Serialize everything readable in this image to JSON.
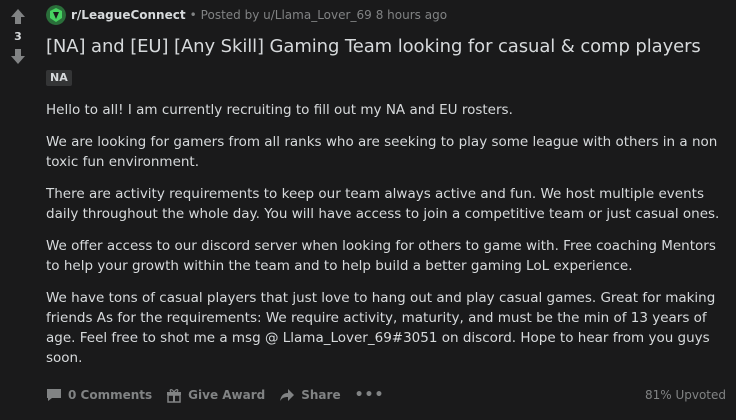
{
  "vote": {
    "count": "3"
  },
  "meta": {
    "subreddit": "r/LeagueConnect",
    "separator": "•",
    "posted_by": "Posted by",
    "author": "u/Llama_Lover_69",
    "time": "8 hours ago"
  },
  "post": {
    "title": "[NA] and [EU] [Any Skill] Gaming Team looking for casual & comp players",
    "flair": "NA",
    "paragraphs": [
      "Hello to all! I am currently recruiting to fill out my NA and EU rosters.",
      "We are looking for gamers from all ranks who are seeking to play some league with others in a non toxic fun environment.",
      "There are activity requirements to keep our team always active and fun. We host multiple events daily throughout the whole day. You will have access to join a competitive team or just casual ones.",
      "We offer access to our discord server when looking for others to game with. Free coaching Mentors to help your growth within the team and to help build a better gaming LoL experience.",
      "We have tons of casual players that just love to hang out and play casual games. Great for making friends As for the requirements: We require activity, maturity, and must be the min of 13 years of age. Feel free to shot me a msg @ Llama_Lover_69#3051 on discord. Hope to hear from you guys soon."
    ]
  },
  "actions": {
    "comments": "0 Comments",
    "award": "Give Award",
    "share": "Share",
    "more": "•••",
    "upvoted": "81% Upvoted"
  },
  "colors": {
    "background": "#1a1a1b",
    "text": "#d7dadc",
    "muted": "#818384",
    "flair_bg": "#343536",
    "icon_green": "#46d160"
  }
}
